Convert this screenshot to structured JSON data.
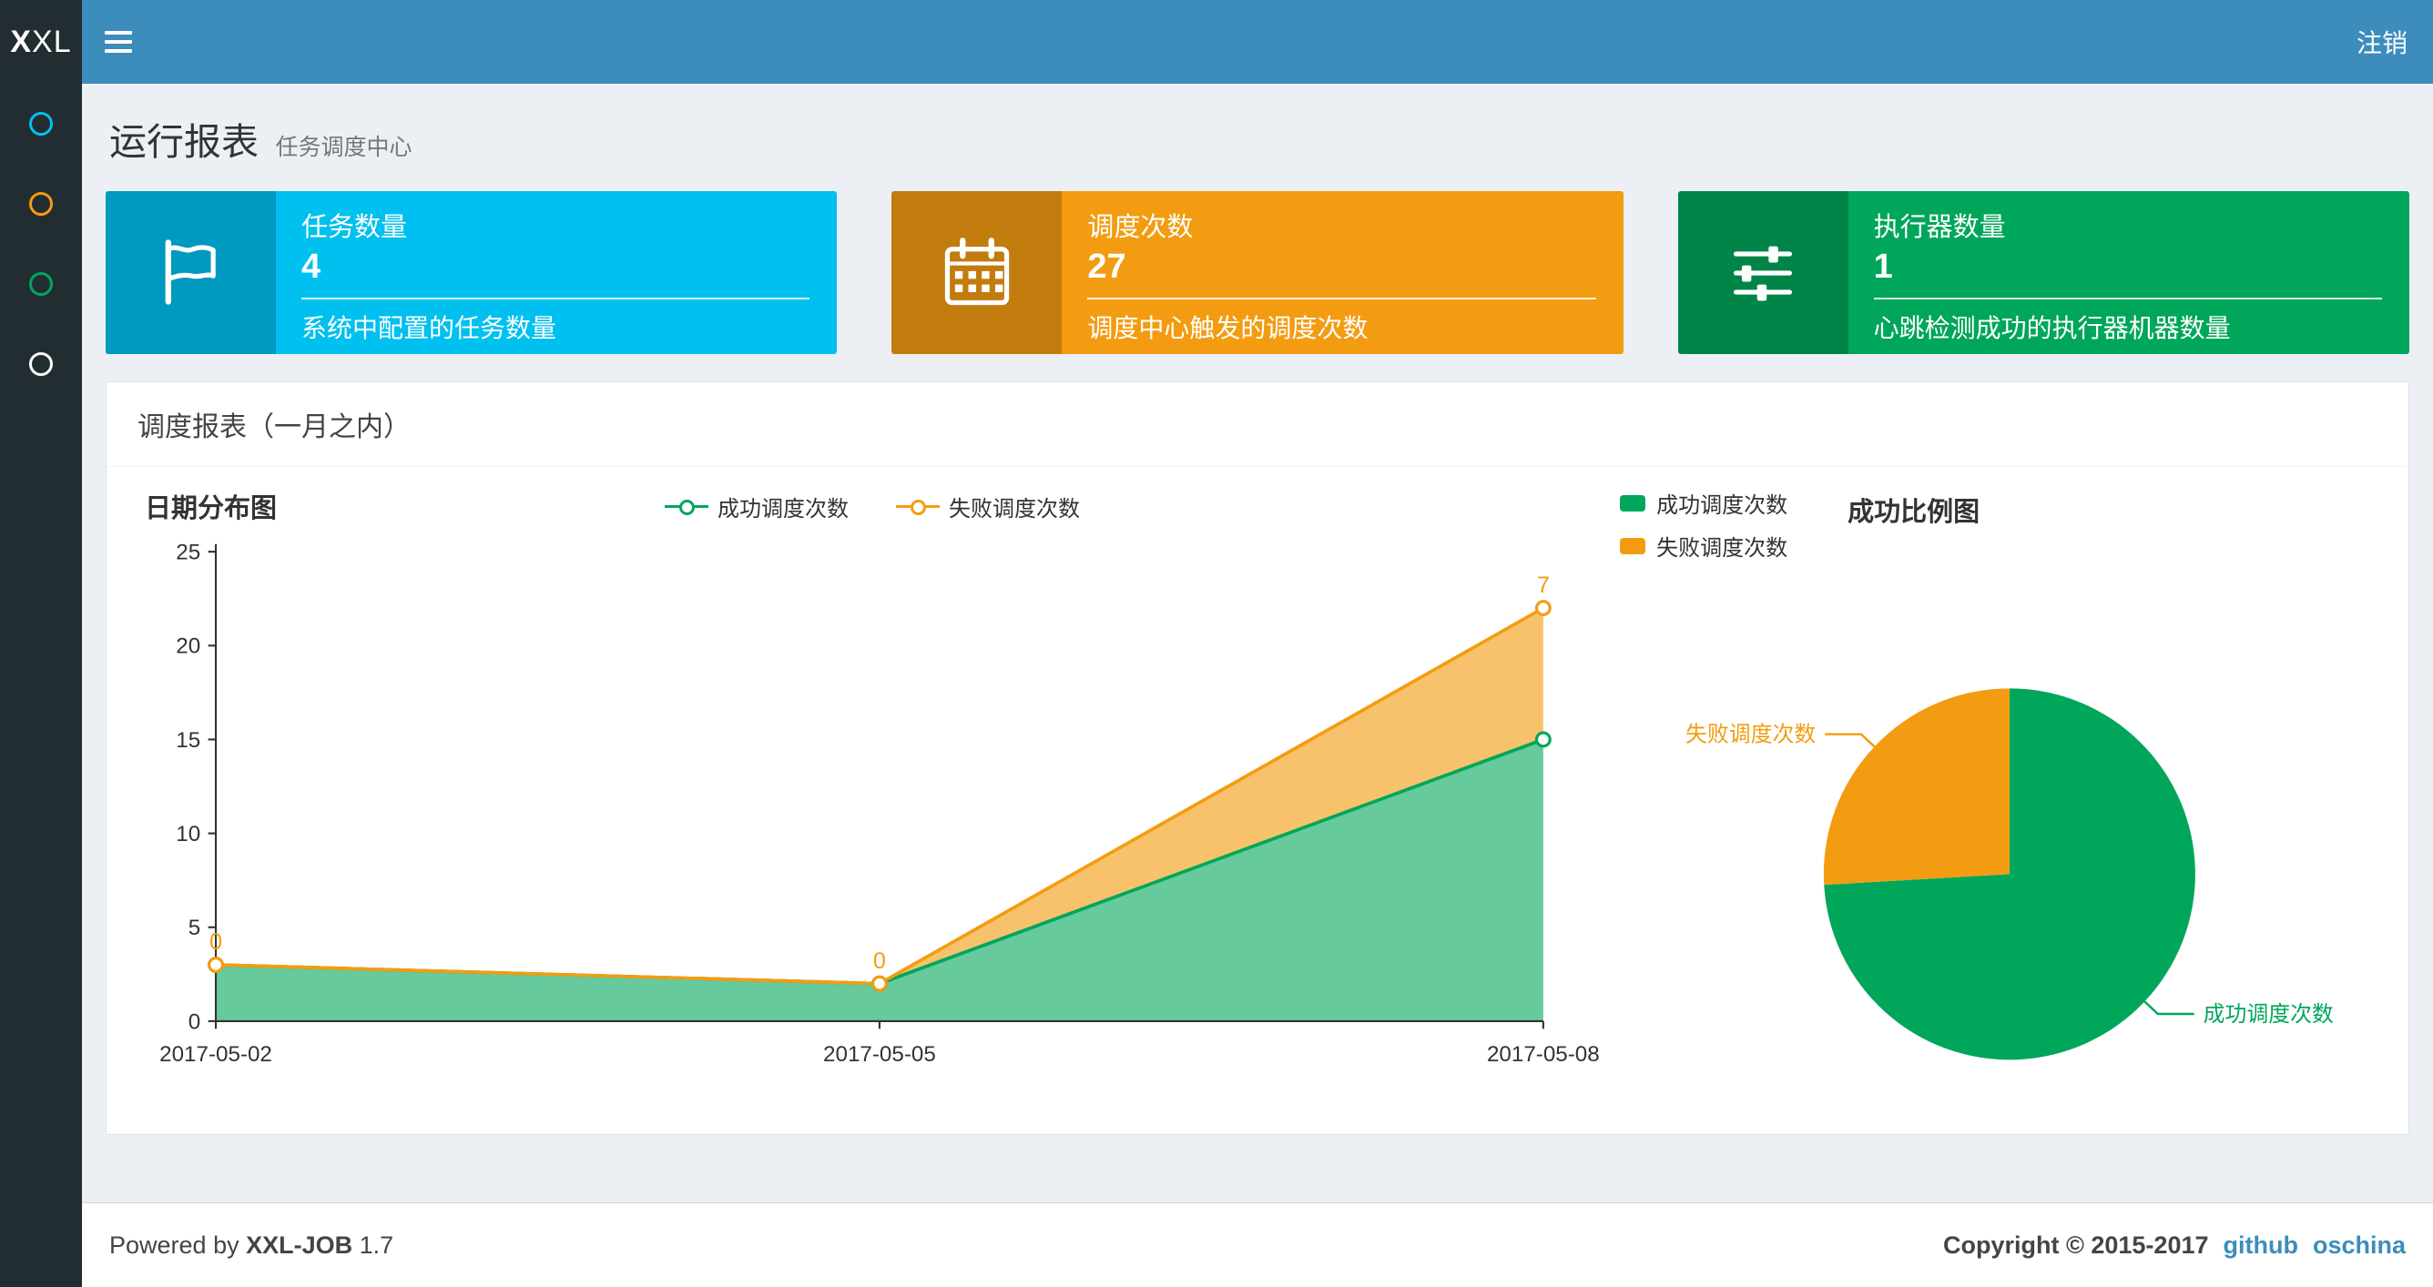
{
  "topbar": {
    "logo_bold": "X",
    "logo_rest": "XL",
    "logout_label": "注销"
  },
  "sidebar": {
    "items": [
      {
        "name": "menu-item-1",
        "icon": "circle-o-icon",
        "color": "#00c0ef"
      },
      {
        "name": "menu-item-2",
        "icon": "circle-o-icon",
        "color": "#f39c12"
      },
      {
        "name": "menu-item-3",
        "icon": "circle-o-icon",
        "color": "#00a65a"
      },
      {
        "name": "menu-item-4",
        "icon": "circle-o-icon",
        "color": "#ffffff"
      }
    ]
  },
  "page": {
    "title": "运行报表",
    "subtitle": "任务调度中心"
  },
  "info_boxes": [
    {
      "icon": "flag-icon",
      "label": "任务数量",
      "value": "4",
      "desc": "系统中配置的任务数量",
      "color": "#00c0ef"
    },
    {
      "icon": "calendar-icon",
      "label": "调度次数",
      "value": "27",
      "desc": "调度中心触发的调度次数",
      "color": "#f39c12"
    },
    {
      "icon": "sliders-icon",
      "label": "执行器数量",
      "value": "1",
      "desc": "心跳检测成功的执行器机器数量",
      "color": "#00a65a"
    }
  ],
  "panel": {
    "title": "调度报表（一月之内）"
  },
  "chart_data": [
    {
      "type": "area",
      "title": "日期分布图",
      "x": [
        "2017-05-02",
        "2017-05-05",
        "2017-05-08"
      ],
      "series": [
        {
          "name": "成功调度次数",
          "values": [
            3,
            2,
            15
          ],
          "color": "#00a65a"
        },
        {
          "name": "失败调度次数",
          "values": [
            0,
            0,
            7
          ],
          "color": "#f39c12",
          "labels": [
            "0",
            "0",
            "7"
          ]
        }
      ],
      "stacked": true,
      "ylim": [
        0,
        25
      ],
      "yticks": [
        0,
        5,
        10,
        15,
        20,
        25
      ],
      "grid": false,
      "legend_position": "top-center"
    },
    {
      "type": "pie",
      "title": "成功比例图",
      "slices": [
        {
          "label": "成功调度次数",
          "value": 20,
          "color": "#00a65a"
        },
        {
          "label": "失败调度次数",
          "value": 7,
          "color": "#f39c12"
        }
      ],
      "legend_position": "top-left"
    }
  ],
  "footer": {
    "powered_prefix": "Powered by",
    "product": "XXL-JOB",
    "version": "1.7",
    "copyright": "Copyright © 2015-2017",
    "links": [
      "github",
      "oschina"
    ]
  },
  "colors": {
    "topbar": "#3c8dbc",
    "sidebar": "#222d32",
    "background": "#ecf0f5",
    "link": "#3c8dbc"
  }
}
